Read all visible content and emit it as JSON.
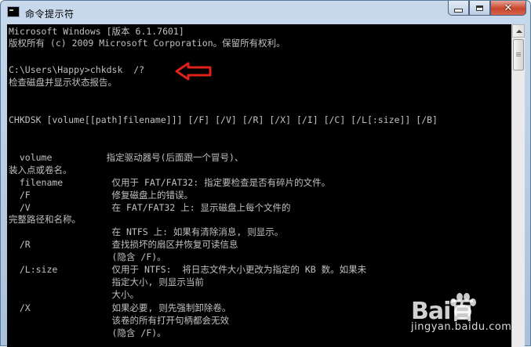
{
  "window": {
    "title": "命令提示符",
    "icon": "console-app-icon"
  },
  "caption_buttons": {
    "minimize": "minimize-icon",
    "maximize": "maximize-icon",
    "close": "✕"
  },
  "console": {
    "lines": [
      "Microsoft Windows [版本 6.1.7601]",
      "版权所有 (c) 2009 Microsoft Corporation。保留所有权利。",
      "",
      "C:\\Users\\Happy>chkdsk  /?",
      "检查磁盘并显示状态报告。",
      "",
      "",
      "CHKDSK [volume[[path]filename]]] [/F] [/V] [/R] [/X] [/I] [/C] [/L[:size]] [/B]",
      "",
      "",
      "",
      "  volume          指定驱动器号(后面跟一个冒号)、",
      "装入点或卷名。",
      "  filename         仅用于 FAT/FAT32: 指定要检查是否有碎片的文件。",
      "  /F               修复磁盘上的错误。",
      "  /V               在 FAT/FAT32 上: 显示磁盘上每个文件的",
      "完整路径和名称。",
      "                   在 NTFS 上: 如果有清除消息, 则显示。",
      "  /R               查找损坏的扇区并恢复可读信息",
      "                   (隐含 /F)。",
      "  /L:size          仅用于 NTFS:  将日志文件大小更改为指定的 KB 数。如果未",
      "                   指定大小, 则显示当前",
      "                   大小。",
      "  /X               如果必要, 则先强制卸除卷。",
      "                   该卷的所有打开句柄都会无效",
      "                   (隐含 /F)。"
    ]
  },
  "colors": {
    "console_bg": "#000000",
    "console_text": "#c0c0c0",
    "arrow": "#e0201a"
  },
  "watermark": {
    "brand": "Bai百",
    "url": "jingyan.baidu.com"
  }
}
